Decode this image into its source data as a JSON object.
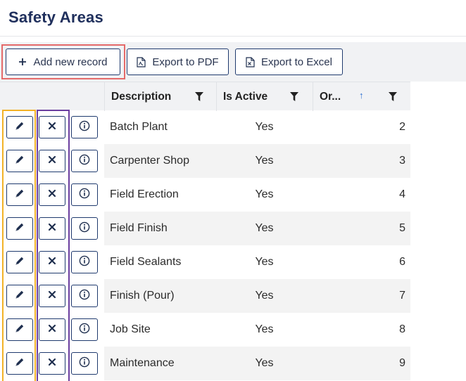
{
  "page": {
    "title": "Safety Areas"
  },
  "toolbar": {
    "add_label": "Add new record",
    "pdf_label": "Export to PDF",
    "excel_label": "Export to Excel"
  },
  "table": {
    "columns": {
      "description": "Description",
      "is_active": "Is Active",
      "order": "Or..."
    },
    "sort_indicator": "↑",
    "rows": [
      {
        "description": "Batch Plant",
        "is_active": "Yes",
        "order": "2"
      },
      {
        "description": "Carpenter Shop",
        "is_active": "Yes",
        "order": "3"
      },
      {
        "description": "Field Erection",
        "is_active": "Yes",
        "order": "4"
      },
      {
        "description": "Field Finish",
        "is_active": "Yes",
        "order": "5"
      },
      {
        "description": "Field Sealants",
        "is_active": "Yes",
        "order": "6"
      },
      {
        "description": "Finish (Pour)",
        "is_active": "Yes",
        "order": "7"
      },
      {
        "description": "Job Site",
        "is_active": "Yes",
        "order": "8"
      },
      {
        "description": "Maintenance",
        "is_active": "Yes",
        "order": "9"
      }
    ]
  },
  "colors": {
    "title": "#1f2f5c",
    "button_border": "#1f3a6e",
    "highlight_add": "#e46a6a",
    "highlight_edit_column": "#f2b228",
    "highlight_delete_column": "#6b3fa0",
    "sort_arrow": "#2a6fd0"
  },
  "icons": {
    "add": "plus-icon",
    "pdf": "pdf-file-icon",
    "excel": "excel-file-icon",
    "filter": "filter-icon",
    "edit": "pencil-icon",
    "delete": "x-icon",
    "info": "info-icon"
  }
}
